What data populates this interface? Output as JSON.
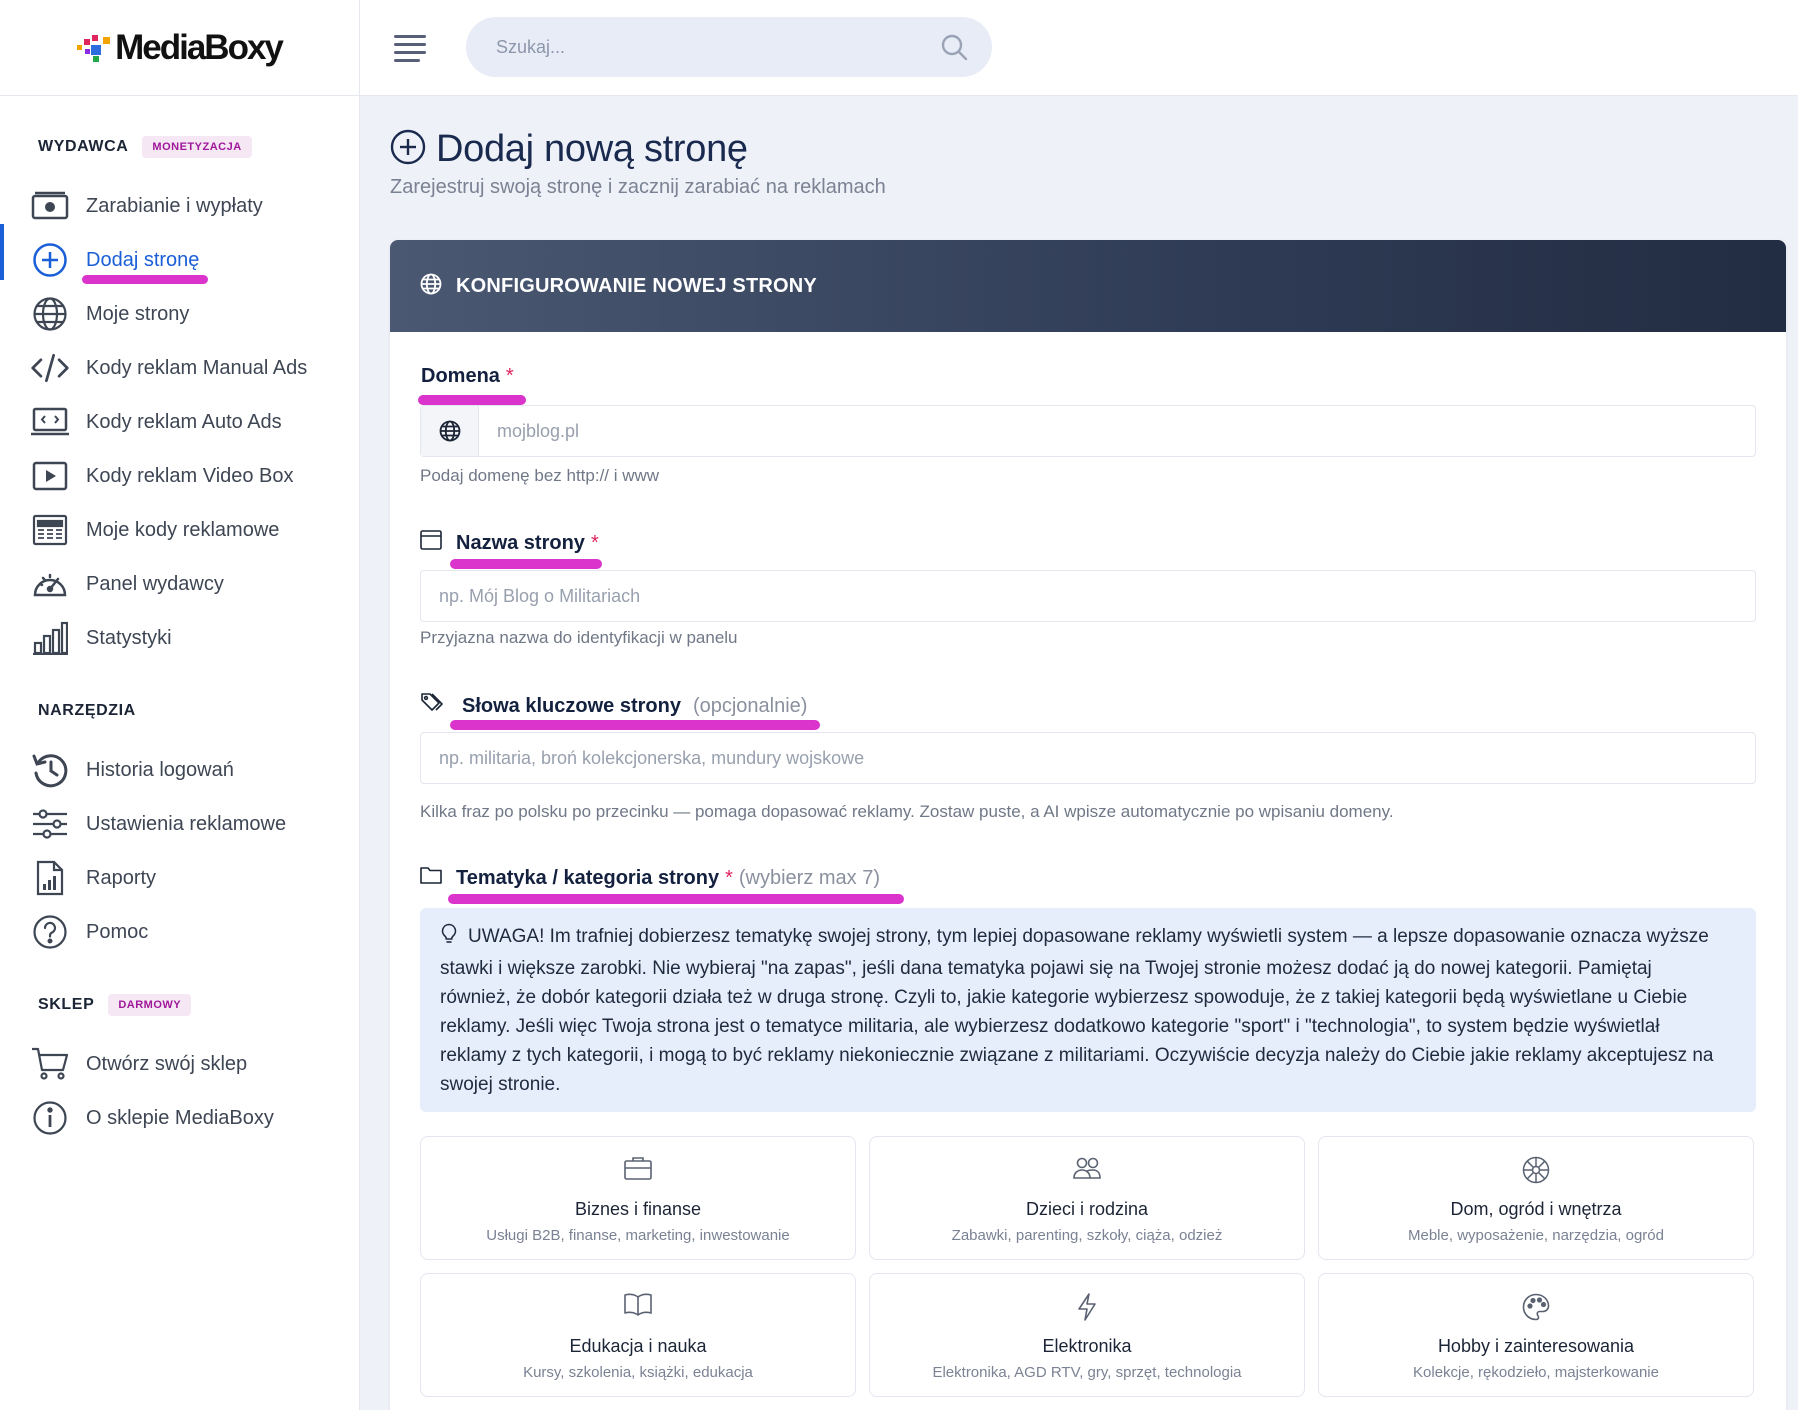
{
  "brand": {
    "name": "MediaBoxy"
  },
  "search": {
    "placeholder": "Szukaj..."
  },
  "sidebar": {
    "sections": [
      {
        "title": "WYDAWCA",
        "badge": "MONETYZACJA",
        "items": [
          {
            "label": "Zarabianie i wypłaty",
            "icon": "money-icon"
          },
          {
            "label": "Dodaj stronę",
            "icon": "plus-circle-icon",
            "active": true
          },
          {
            "label": "Moje strony",
            "icon": "globe-icon"
          },
          {
            "label": "Kody reklam Manual Ads",
            "icon": "code-icon"
          },
          {
            "label": "Kody reklam Auto Ads",
            "icon": "laptop-code-icon"
          },
          {
            "label": "Kody reklam Video Box",
            "icon": "video-icon"
          },
          {
            "label": "Moje kody reklamowe",
            "icon": "newspaper-icon"
          },
          {
            "label": "Panel wydawcy",
            "icon": "speedometer-icon"
          },
          {
            "label": "Statystyki",
            "icon": "bar-chart-icon"
          }
        ]
      },
      {
        "title": "NARZĘDZIA",
        "badge": "",
        "items": [
          {
            "label": "Historia logowań",
            "icon": "history-icon"
          },
          {
            "label": "Ustawienia reklamowe",
            "icon": "sliders-icon"
          },
          {
            "label": "Raporty",
            "icon": "report-icon"
          },
          {
            "label": "Pomoc",
            "icon": "help-icon"
          }
        ]
      },
      {
        "title": "SKLEP",
        "badge": "DARMOWY",
        "items": [
          {
            "label": "Otwórz swój sklep",
            "icon": "cart-icon"
          },
          {
            "label": "O sklepie MediaBoxy",
            "icon": "info-icon"
          }
        ]
      }
    ]
  },
  "page": {
    "title": "Dodaj nową stronę",
    "subtitle": "Zarejestruj swoją stronę i zacznij zarabiać na reklamach"
  },
  "card": {
    "header": "KONFIGUROWANIE NOWEJ STRONY",
    "domain": {
      "label": "Domena",
      "required": "*",
      "placeholder": "mojblog.pl",
      "help": "Podaj domenę bez http:// i www"
    },
    "site_name": {
      "label": "Nazwa strony",
      "required": "*",
      "placeholder": "np. Mój Blog o Militariach",
      "help": "Przyjazna nazwa do identyfikacji w panelu"
    },
    "keywords": {
      "label": "Słowa kluczowe strony",
      "optional": "(opcjonalnie)",
      "placeholder": "np. militaria, broń kolekcjonerska, mundury wojskowe",
      "help": "Kilka fraz po polsku po przecinku — pomaga dopasować reklamy. Zostaw puste, a AI wpisze automatycznie po wpisaniu domeny."
    },
    "category": {
      "label": "Tematyka / kategoria strony",
      "required": "*",
      "hint": "(wybierz max 7)",
      "notice": "UWAGA! Im trafniej dobierzesz tematykę swojej strony, tym lepiej dopasowane reklamy wyświetli system — a lepsze dopasowanie oznacza wyższe stawki i większe zarobki. Nie wybieraj \"na zapas\", jeśli dana tematyka pojawi się na Twojej stronie możesz dodać ją do nowej kategorii. Pamiętaj również, że dobór kategorii działa też w druga stronę. Czyli to, jakie kategorie wybierzesz spowoduje, że z takiej kategorii będą wyświetlane u Ciebie reklamy. Jeśli więc Twoja strona jest o tematyce militaria, ale wybierzesz dodatkowo kategorie \"sport\" i \"technologia\", to system będzie wyświetlał reklamy z tych kategorii, i mogą to być reklamy niekoniecznie związane z militariami. Oczywiście decyzja należy do Ciebie jakie reklamy akceptujesz na swojej stronie."
    },
    "categories": [
      {
        "title": "Biznes i finanse",
        "desc": "Usługi B2B, finanse, marketing, inwestowanie",
        "icon": "briefcase-icon"
      },
      {
        "title": "Dzieci i rodzina",
        "desc": "Zabawki, parenting, szkoły, ciąża, odzież",
        "icon": "people-icon"
      },
      {
        "title": "Dom, ogród i wnętrza",
        "desc": "Meble, wyposażenie, narzędzia, ogród",
        "icon": "flower-icon"
      },
      {
        "title": "Edukacja i nauka",
        "desc": "Kursy, szkolenia, książki, edukacja",
        "icon": "book-icon"
      },
      {
        "title": "Elektronika",
        "desc": "Elektronika, AGD RTV, gry, sprzęt, technologia",
        "icon": "lightning-icon"
      },
      {
        "title": "Hobby i zainteresowania",
        "desc": "Kolekcje, rękodzieło, majsterkowanie",
        "icon": "palette-icon"
      }
    ]
  },
  "colors": {
    "accent": "#1a5fd7",
    "highlight": "#d411c4",
    "badge": "#a0179b",
    "required": "#e0245e"
  }
}
